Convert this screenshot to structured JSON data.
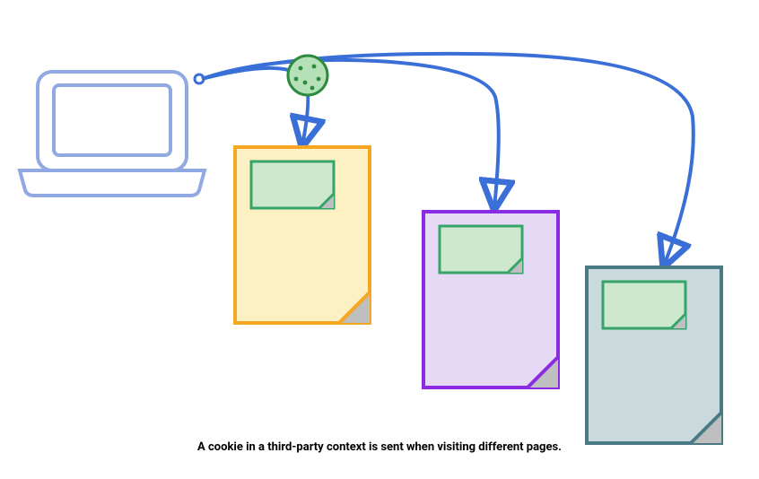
{
  "caption": "A cookie in a third-party context is sent when visiting different pages.",
  "nodes": {
    "laptop": {
      "label": "client-laptop",
      "stroke": "#90a9e3",
      "fill": "#ffffff"
    },
    "cookie": {
      "label": "cookie-icon",
      "stroke": "#2b8a3e",
      "fill": "#b5e0b8"
    },
    "embedded_resource": {
      "stroke": "#35a36a",
      "fill": "#cde8cd"
    },
    "pages": [
      {
        "id": "page-1",
        "stroke": "#f5a623",
        "fill": "#fdf0c2"
      },
      {
        "id": "page-2",
        "stroke": "#8a2be2",
        "fill": "#e6d9f5"
      },
      {
        "id": "page-3",
        "stroke": "#4a7a86",
        "fill": "#c9d9dc"
      }
    ]
  },
  "edges": [
    {
      "from": "laptop",
      "to": "page-1",
      "via": "cookie"
    },
    {
      "from": "laptop",
      "to": "page-2",
      "via": "cookie"
    },
    {
      "from": "laptop",
      "to": "page-3",
      "via": "cookie"
    }
  ],
  "colors": {
    "arrow": "#3a6fd8",
    "fold_shadow": "#bfbfbf"
  }
}
